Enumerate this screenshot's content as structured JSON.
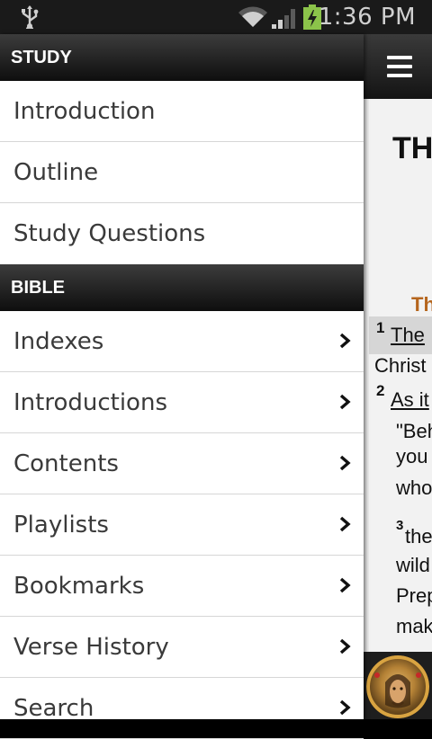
{
  "status_bar": {
    "time": "1:36 PM",
    "icons": [
      "usb-icon",
      "wifi-icon",
      "signal-icon",
      "battery-charging-icon"
    ]
  },
  "drawer": {
    "study": {
      "header": "STUDY",
      "items": [
        {
          "label": "Introduction"
        },
        {
          "label": "Outline"
        },
        {
          "label": "Study Questions"
        }
      ]
    },
    "bible": {
      "header": "BIBLE",
      "items": [
        {
          "label": "Indexes"
        },
        {
          "label": "Introductions"
        },
        {
          "label": "Contents"
        },
        {
          "label": "Playlists"
        },
        {
          "label": "Bookmarks"
        },
        {
          "label": "Verse History"
        },
        {
          "label": "Search"
        }
      ]
    }
  },
  "reader": {
    "heading": "TH",
    "section_title": "Th",
    "verse1_num": "1",
    "verse1_text": "The",
    "verse1_cont": "Christ",
    "verse2_num": "2",
    "verse2_text": "As it",
    "quote1": "\"Beh",
    "quote2": "you",
    "quote3": "who",
    "verse3_num": "3",
    "verse3_text": "the",
    "line_wild": "wild",
    "line_prep": "Prep",
    "line_mak": "mak",
    "accent_color": "#b5651d"
  }
}
